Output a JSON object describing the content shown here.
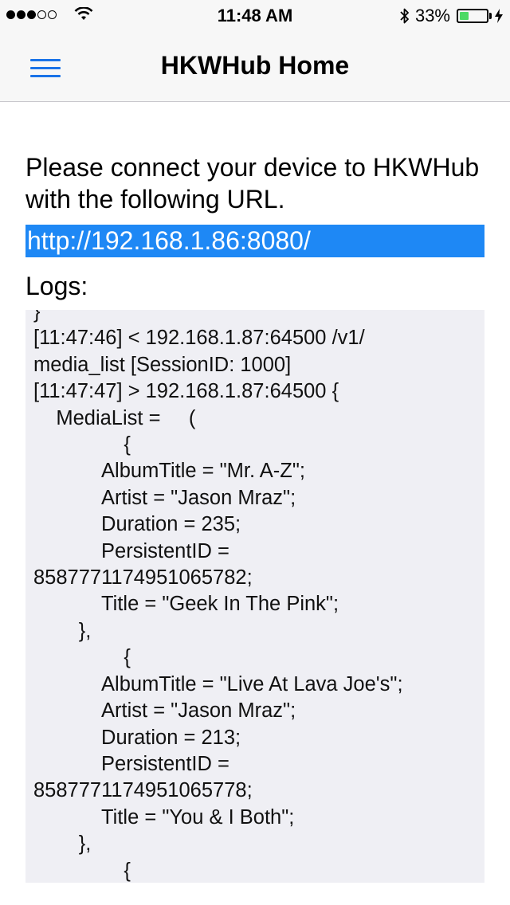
{
  "status_bar": {
    "time": "11:48 AM",
    "battery_percent": "33%",
    "battery_level": 0.33,
    "signal_bars_filled": 3,
    "signal_bars_total": 5
  },
  "nav": {
    "title": "HKWHub Home",
    "menu_icon": "hamburger-menu-icon"
  },
  "main": {
    "instruction": "Please connect your device to HKWHub with the following URL.",
    "url": "http://192.168.1.86:8080/",
    "logs_label": "Logs:",
    "log_content": "}\n[11:47:46] < 192.168.1.87:64500 /v1/\nmedia_list [SessionID: 1000]\n[11:47:47] > 192.168.1.87:64500 {\n    MediaList =     (\n                {\n            AlbumTitle = \"Mr. A-Z\";\n            Artist = \"Jason Mraz\";\n            Duration = 235;\n            PersistentID =\n8587771174951065782;\n            Title = \"Geek In The Pink\";\n        },\n                {\n            AlbumTitle = \"Live At Lava Joe's\";\n            Artist = \"Jason Mraz\";\n            Duration = 213;\n            PersistentID =\n8587771174951065778;\n            Title = \"You & I Both\";\n        },\n                {"
  },
  "colors": {
    "accent": "#1a73e8",
    "url_highlight": "#1e88f5",
    "battery_fill": "#4cd964",
    "log_background": "#efeff4"
  }
}
